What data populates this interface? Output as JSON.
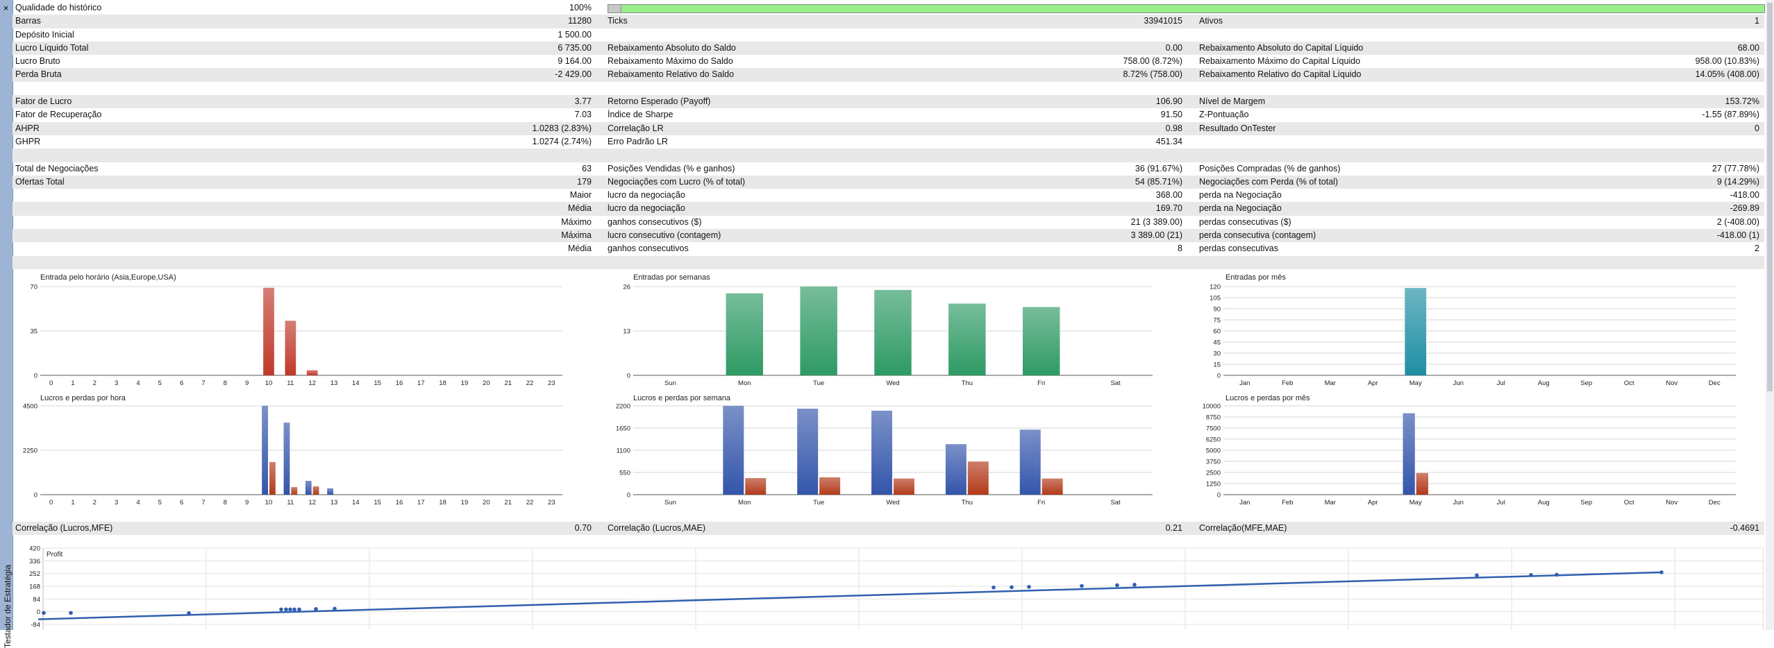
{
  "window": {
    "close_label": "×",
    "side_label": "Testador de Estratégia"
  },
  "history_quality": {
    "label": "Qualidade do histórico",
    "value": "100%",
    "fraction": 1.0
  },
  "stats_rows": [
    {
      "l1": "Barras",
      "v1": "11280",
      "l2": "Ticks",
      "v2": "33941015",
      "l3": "Ativos",
      "v3": "1"
    },
    {
      "l1": "Depósito Inicial",
      "v1": "1 500.00",
      "l2": "",
      "v2": "",
      "l3": "",
      "v3": ""
    },
    {
      "l1": "Lucro Líquido Total",
      "v1": "6 735.00",
      "l2": "Rebaixamento Absoluto do Saldo",
      "v2": "0.00",
      "l3": "Rebaixamento Absoluto do Capital Líquido",
      "v3": "68.00"
    },
    {
      "l1": "Lucro Bruto",
      "v1": "9 164.00",
      "l2": "Rebaixamento Máximo do Saldo",
      "v2": "758.00 (8.72%)",
      "l3": "Rebaixamento Máximo do Capital Líquido",
      "v3": "958.00 (10.83%)"
    },
    {
      "l1": "Perda Bruta",
      "v1": "-2 429.00",
      "l2": "Rebaixamento Relativo do Saldo",
      "v2": "8.72% (758.00)",
      "l3": "Rebaixamento Relativo do Capital Líquido",
      "v3": "14.05% (408.00)"
    },
    {
      "l1": "",
      "v1": "",
      "l2": "",
      "v2": "",
      "l3": "",
      "v3": ""
    },
    {
      "l1": "Fator de Lucro",
      "v1": "3.77",
      "l2": "Retorno Esperado (Payoff)",
      "v2": "106.90",
      "l3": "Nível de Margem",
      "v3": "153.72%"
    },
    {
      "l1": "Fator de Recuperação",
      "v1": "7.03",
      "l2": "Índice de Sharpe",
      "v2": "91.50",
      "l3": "Z-Pontuação",
      "v3": "-1.55 (87.89%)"
    },
    {
      "l1": "AHPR",
      "v1": "1.0283 (2.83%)",
      "l2": "Correlação LR",
      "v2": "0.98",
      "l3": "Resultado OnTester",
      "v3": "0"
    },
    {
      "l1": "GHPR",
      "v1": "1.0274 (2.74%)",
      "l2": "Erro Padrão LR",
      "v2": "451.34",
      "l3": "",
      "v3": ""
    },
    {
      "l1": "",
      "v1": "",
      "l2": "",
      "v2": "",
      "l3": "",
      "v3": ""
    },
    {
      "l1": "Total de Negociações",
      "v1": "63",
      "l2": "Posições Vendidas (% e ganhos)",
      "v2": "36 (91.67%)",
      "l3": "Posições Compradas (% de ganhos)",
      "v3": "27 (77.78%)"
    },
    {
      "l1": "Ofertas Total",
      "v1": "179",
      "l2": "Negociações com Lucro (% of total)",
      "v2": "54 (85.71%)",
      "l3": "Negociações com Perda (% of total)",
      "v3": "9 (14.29%)"
    },
    {
      "l1": "",
      "v1": "Maior",
      "l2": "lucro da negociação",
      "v2": "368.00",
      "l3": "perda na Negociação",
      "v3": "-418.00"
    },
    {
      "l1": "",
      "v1": "Média",
      "l2": "lucro da negociação",
      "v2": "169.70",
      "l3": "perda na Negociação",
      "v3": "-269.89"
    },
    {
      "l1": "",
      "v1": "Máximo",
      "l2": "ganhos consecutivos ($)",
      "v2": "21 (3 389.00)",
      "l3": "perdas consecutivas ($)",
      "v3": "2 (-408.00)"
    },
    {
      "l1": "",
      "v1": "Máxima",
      "l2": "lucro consecutivo (contagem)",
      "v2": "3 389.00 (21)",
      "l3": "perda consecutiva (contagem)",
      "v3": "-418.00 (1)"
    },
    {
      "l1": "",
      "v1": "Média",
      "l2": "ganhos consecutivos",
      "v2": "8",
      "l3": "perdas consecutivas",
      "v3": "2"
    },
    {
      "l1": "",
      "v1": "",
      "l2": "",
      "v2": "",
      "l3": "",
      "v3": ""
    }
  ],
  "correlations": {
    "l1": "Correlação (Lucros,MFE)",
    "v1": "0.70",
    "l2": "Correlação (Lucros,MAE)",
    "v2": "0.21",
    "l3": "Correlação(MFE,MAE)",
    "v3": "-0.4691"
  },
  "colors": {
    "entry_hour": "#c0392b",
    "entry_week": "#2e9a64",
    "entry_month": "#1f8ea3",
    "profit": "#3355aa",
    "loss": "#b23a1a",
    "line": "#2f5fb0",
    "quality": "#98f08a"
  },
  "chart_data": [
    {
      "id": "entries-hour",
      "type": "bar",
      "title": "Entrada pelo horário (Asia,Europe,USA)",
      "categories": [
        "0",
        "1",
        "2",
        "3",
        "4",
        "5",
        "6",
        "7",
        "8",
        "9",
        "10",
        "11",
        "12",
        "13",
        "14",
        "15",
        "16",
        "17",
        "18",
        "19",
        "20",
        "21",
        "22",
        "23"
      ],
      "series": [
        {
          "values": [
            0,
            0,
            0,
            0,
            0,
            0,
            0,
            0,
            0,
            0,
            69,
            43,
            4,
            0,
            0,
            0,
            0,
            0,
            0,
            0,
            0,
            0,
            0,
            0
          ]
        }
      ],
      "yticks": [
        "0",
        "35",
        "70"
      ],
      "ylim": [
        0,
        70
      ]
    },
    {
      "id": "entries-week",
      "type": "bar",
      "title": "Entradas por semanas",
      "categories": [
        "Sun",
        "Mon",
        "Tue",
        "Wed",
        "Thu",
        "Fri",
        "Sat"
      ],
      "series": [
        {
          "values": [
            0,
            24,
            26,
            25,
            21,
            20,
            0
          ]
        }
      ],
      "yticks": [
        "0",
        "13",
        "26"
      ],
      "ylim": [
        0,
        26
      ]
    },
    {
      "id": "entries-month",
      "type": "bar",
      "title": "Entradas por mês",
      "categories": [
        "Jan",
        "Feb",
        "Mar",
        "Apr",
        "May",
        "Jun",
        "Jul",
        "Aug",
        "Sep",
        "Oct",
        "Nov",
        "Dec"
      ],
      "series": [
        {
          "values": [
            0,
            0,
            0,
            0,
            118,
            0,
            0,
            0,
            0,
            0,
            0,
            0
          ]
        }
      ],
      "yticks": [
        "0",
        "15",
        "30",
        "45",
        "60",
        "75",
        "90",
        "105",
        "120"
      ],
      "ylim": [
        0,
        120
      ]
    },
    {
      "id": "pl-hour",
      "type": "bar",
      "title": "Lucros e perdas por hora",
      "categories": [
        "0",
        "1",
        "2",
        "3",
        "4",
        "5",
        "6",
        "7",
        "8",
        "9",
        "10",
        "11",
        "12",
        "13",
        "14",
        "15",
        "16",
        "17",
        "18",
        "19",
        "20",
        "21",
        "22",
        "23"
      ],
      "series": [
        {
          "values": [
            0,
            0,
            0,
            0,
            0,
            0,
            0,
            0,
            0,
            0,
            4500,
            3650,
            700,
            320,
            0,
            0,
            0,
            0,
            0,
            0,
            0,
            0,
            0,
            0
          ]
        },
        {
          "values": [
            0,
            0,
            0,
            0,
            0,
            0,
            0,
            0,
            0,
            0,
            1650,
            380,
            420,
            0,
            0,
            0,
            0,
            0,
            0,
            0,
            0,
            0,
            0,
            0
          ]
        }
      ],
      "yticks": [
        "0",
        "2250",
        "4500"
      ],
      "ylim": [
        0,
        4500
      ]
    },
    {
      "id": "pl-week",
      "type": "bar",
      "title": "Lucros e perdas por semana",
      "categories": [
        "Sun",
        "Mon",
        "Tue",
        "Wed",
        "Thu",
        "Fri",
        "Sat"
      ],
      "series": [
        {
          "values": [
            0,
            2200,
            2130,
            2080,
            1250,
            1610,
            0
          ]
        },
        {
          "values": [
            0,
            410,
            430,
            400,
            820,
            400,
            0
          ]
        }
      ],
      "yticks": [
        "0",
        "550",
        "1100",
        "1650",
        "2200"
      ],
      "ylim": [
        0,
        2200
      ]
    },
    {
      "id": "pl-month",
      "type": "bar",
      "title": "Lucros e perdas por mês",
      "categories": [
        "Jan",
        "Feb",
        "Mar",
        "Apr",
        "May",
        "Jun",
        "Jul",
        "Aug",
        "Sep",
        "Oct",
        "Nov",
        "Dec"
      ],
      "series": [
        {
          "values": [
            0,
            0,
            0,
            0,
            9164,
            0,
            0,
            0,
            0,
            0,
            0,
            0
          ]
        },
        {
          "values": [
            0,
            0,
            0,
            0,
            2429,
            0,
            0,
            0,
            0,
            0,
            0,
            0
          ]
        }
      ],
      "yticks": [
        "0",
        "1250",
        "2500",
        "3750",
        "5000",
        "6250",
        "7500",
        "8750",
        "10000"
      ],
      "ylim": [
        0,
        10000
      ]
    },
    {
      "id": "profit-scatter",
      "type": "scatter",
      "legend": "Profit",
      "yticks": [
        "-84",
        "0",
        "84",
        "168",
        "252",
        "336",
        "420"
      ],
      "ylim": [
        -84,
        420
      ],
      "points": [
        [
          0,
          -8
        ],
        [
          1,
          -8
        ],
        [
          2,
          -10
        ],
        [
          3,
          15
        ],
        [
          4,
          15
        ],
        [
          5,
          15
        ],
        [
          6,
          15
        ],
        [
          7,
          15
        ],
        [
          8,
          18
        ],
        [
          9,
          20
        ],
        [
          10,
          160
        ],
        [
          11,
          162
        ],
        [
          12,
          164
        ],
        [
          13,
          170
        ],
        [
          14,
          175
        ],
        [
          15,
          178
        ],
        [
          16,
          240
        ],
        [
          17,
          242
        ],
        [
          18,
          244
        ],
        [
          19,
          260
        ]
      ],
      "trend": [
        [
          0,
          -50
        ],
        [
          19,
          260
        ]
      ]
    }
  ]
}
